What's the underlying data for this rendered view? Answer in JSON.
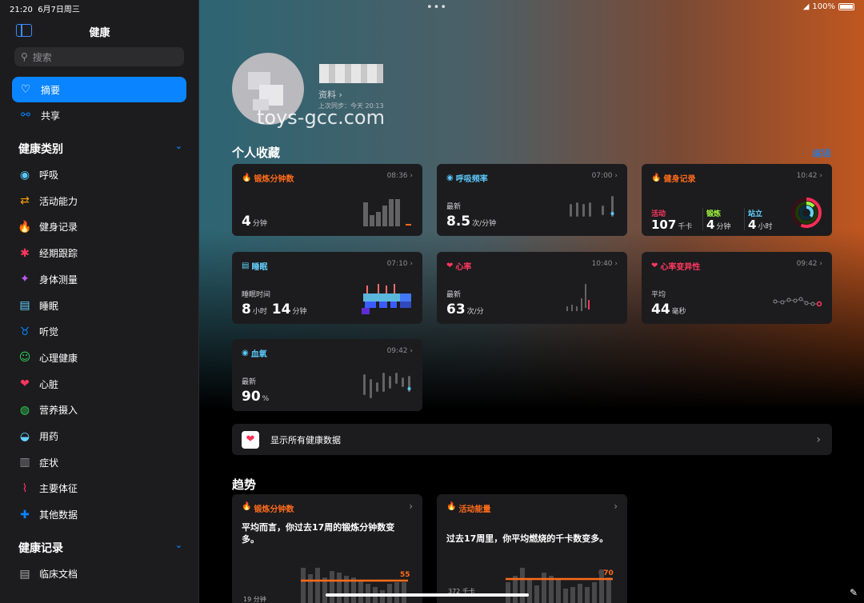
{
  "status": {
    "time": "21:20",
    "date": "6月7日周三",
    "battery": "100%"
  },
  "sidebar": {
    "title": "健康",
    "search_placeholder": "搜索",
    "nav": [
      {
        "label": "摘要",
        "icon": "heart-icon"
      },
      {
        "label": "共享",
        "icon": "people-icon"
      }
    ],
    "categories_title": "健康类别",
    "categories": [
      {
        "label": "呼吸",
        "icon": "lungs-icon",
        "color": "#5ac8fa"
      },
      {
        "label": "活动能力",
        "icon": "arrows-icon",
        "color": "#ff9f0a"
      },
      {
        "label": "健身记录",
        "icon": "flame-icon",
        "color": "#ff6b1a"
      },
      {
        "label": "经期跟踪",
        "icon": "cycle-icon",
        "color": "#ff375f"
      },
      {
        "label": "身体测量",
        "icon": "figure-icon",
        "color": "#bf5af2"
      },
      {
        "label": "睡眠",
        "icon": "bed-icon",
        "color": "#64d2ff"
      },
      {
        "label": "听觉",
        "icon": "ear-icon",
        "color": "#0a84ff"
      },
      {
        "label": "心理健康",
        "icon": "head-icon",
        "color": "#30d158"
      },
      {
        "label": "心脏",
        "icon": "heart-icon",
        "color": "#ff375f"
      },
      {
        "label": "营养摄入",
        "icon": "apple-icon",
        "color": "#30d158"
      },
      {
        "label": "用药",
        "icon": "pills-icon",
        "color": "#64d2ff"
      },
      {
        "label": "症状",
        "icon": "clipboard-icon",
        "color": "#8e8e93"
      },
      {
        "label": "主要体征",
        "icon": "vitals-icon",
        "color": "#ff375f"
      },
      {
        "label": "其他数据",
        "icon": "plus-icon",
        "color": "#0a84ff"
      }
    ],
    "records_title": "健康记录",
    "records": [
      {
        "label": "临床文档",
        "icon": "document-icon"
      }
    ]
  },
  "profile": {
    "link": "资料",
    "sync": "上次同步：今天 20:13"
  },
  "watermark": "toys-gcc.com",
  "favorites": {
    "title": "个人收藏",
    "edit": "编辑"
  },
  "cards": {
    "exercise": {
      "title": "锻炼分钟数",
      "time": "08:36",
      "value": "4",
      "unit": "分钟",
      "color": "#ff6b1a"
    },
    "resp": {
      "title": "呼吸频率",
      "time": "07:00",
      "sub": "最新",
      "value": "8.5",
      "unit": "次/分钟",
      "color": "#5ac8fa"
    },
    "fitness": {
      "title": "健身记录",
      "time": "10:42",
      "color": "#ff6b1a",
      "move": {
        "label": "活动",
        "value": "107",
        "unit": "千卡"
      },
      "exercise": {
        "label": "锻炼",
        "value": "4",
        "unit": "分钟"
      },
      "stand": {
        "label": "站立",
        "value": "4",
        "unit": "小时"
      }
    },
    "sleep": {
      "title": "睡眠",
      "time": "07:10",
      "sub": "睡眠时间",
      "h": "8",
      "hunit": "小时",
      "m": "14",
      "munit": "分钟",
      "color": "#64d2ff"
    },
    "heart": {
      "title": "心率",
      "time": "10:40",
      "sub": "最新",
      "value": "63",
      "unit": "次/分",
      "color": "#ff375f"
    },
    "hrv": {
      "title": "心率变异性",
      "time": "09:42",
      "sub": "平均",
      "value": "44",
      "unit": "毫秒",
      "color": "#ff375f"
    },
    "spo2": {
      "title": "血氧",
      "time": "09:42",
      "sub": "最新",
      "value": "90",
      "unit": "%",
      "color": "#5ac8fa"
    }
  },
  "show_all": "显示所有健康数据",
  "trends": {
    "title": "趋势",
    "exercise": {
      "title": "锻炼分钟数",
      "text": "平均而言，你过去17周的锻炼分钟数变多。",
      "ref": "19 分钟",
      "latest": "55"
    },
    "energy": {
      "title": "活动能量",
      "text": "过去17周里，你平均燃烧的千卡数变多。",
      "ref": "372 千卡",
      "latest": "670"
    }
  }
}
